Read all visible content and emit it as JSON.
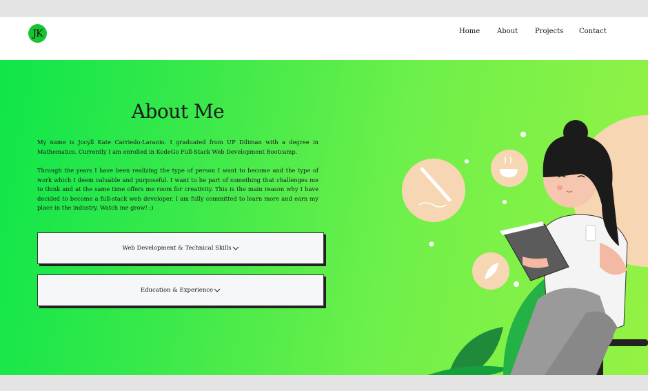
{
  "logo": {
    "text": "JK"
  },
  "nav": {
    "home": "Home",
    "about": "About",
    "projects": "Projects",
    "contact": "Contact"
  },
  "about": {
    "title": "About Me",
    "paragraph1": "My name is Jocyll Kate Carriedo-Laranio. I graduated from UP Diliman with a degree in Mathematics. Currently I am enrolled in KodeGo Full-Stack Web Development Bootcamp.",
    "paragraph2": "Through the years I have been realizing the type of person I want to become and the type of work which I deem valuable and purposeful. I want to be part of something that challenges me to think and at the same time offers me room for creativity. This is the main reason why I have decided to become a full-stack web developer. I am fully committed to learn more and earn my place in the industry. Watch me grow! :)"
  },
  "accordions": [
    {
      "label": "Web Development & Technical Skills",
      "icon": "chevron-down-icon"
    },
    {
      "label": "Education & Experience",
      "icon": "chevron-down-icon"
    }
  ],
  "colors": {
    "accent": "#19c432",
    "hero_start": "#0ee64a",
    "hero_end": "#95f244"
  }
}
